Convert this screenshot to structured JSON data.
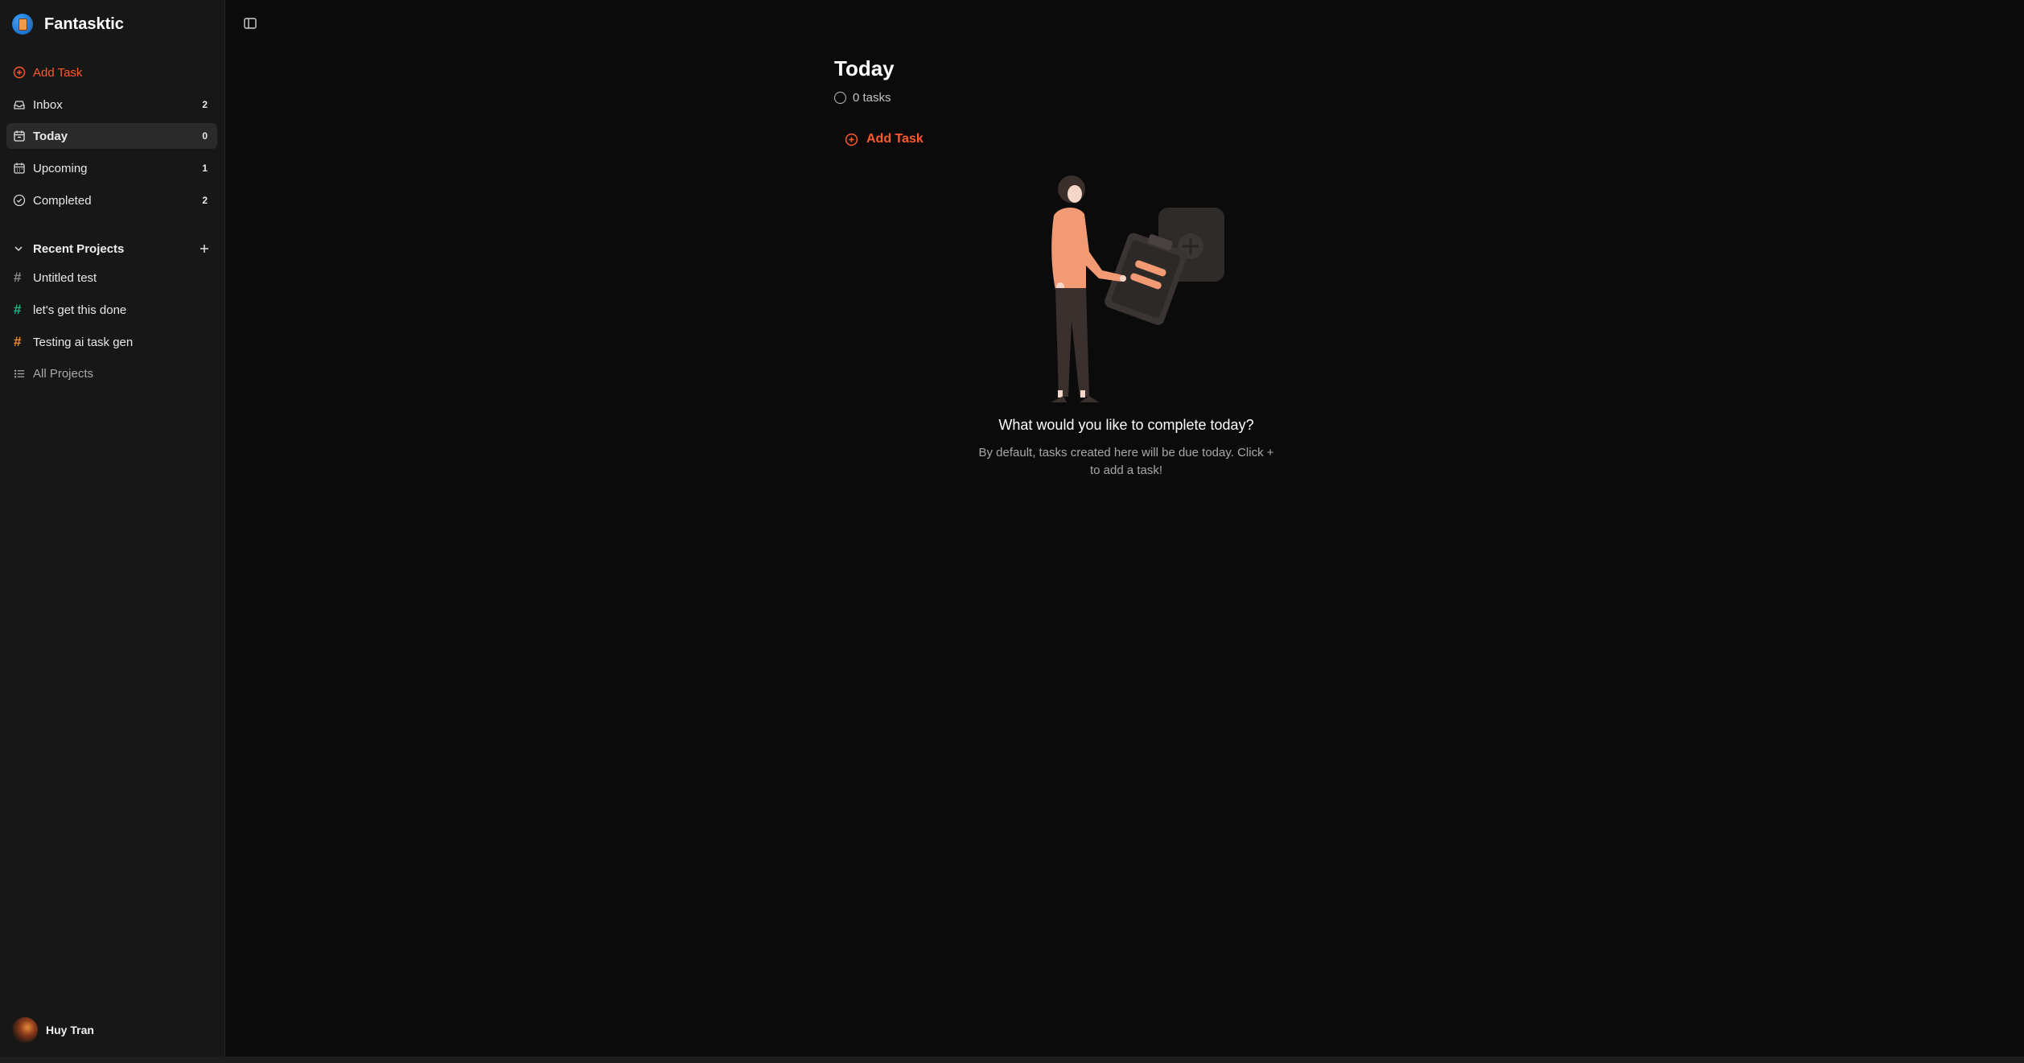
{
  "app": {
    "name": "Fantasktic"
  },
  "sidebar": {
    "add_task": "Add Task",
    "items": [
      {
        "label": "Inbox",
        "count": "2",
        "icon": "inbox-icon"
      },
      {
        "label": "Today",
        "count": "0",
        "icon": "calendar-today-icon",
        "active": true
      },
      {
        "label": "Upcoming",
        "count": "1",
        "icon": "calendar-icon"
      },
      {
        "label": "Completed",
        "count": "2",
        "icon": "check-circle-icon"
      }
    ],
    "recent_projects": {
      "title": "Recent Projects",
      "items": [
        {
          "label": "Untitled test",
          "color": "#8a8a8a"
        },
        {
          "label": "let's get this done",
          "color": "#19b98a"
        },
        {
          "label": "Testing ai task gen",
          "color": "#f08a24"
        }
      ],
      "all_projects": "All Projects"
    },
    "user": {
      "name": "Huy Tran"
    }
  },
  "main": {
    "title": "Today",
    "task_count": "0 tasks",
    "add_task": "Add Task",
    "empty": {
      "title": "What would you like to complete today?",
      "text": "By default, tasks created here will be due today. Click + to add a task!"
    }
  },
  "colors": {
    "accent": "#ff5a2b",
    "background": "#0c0b0b",
    "sidebar": "#171717"
  }
}
